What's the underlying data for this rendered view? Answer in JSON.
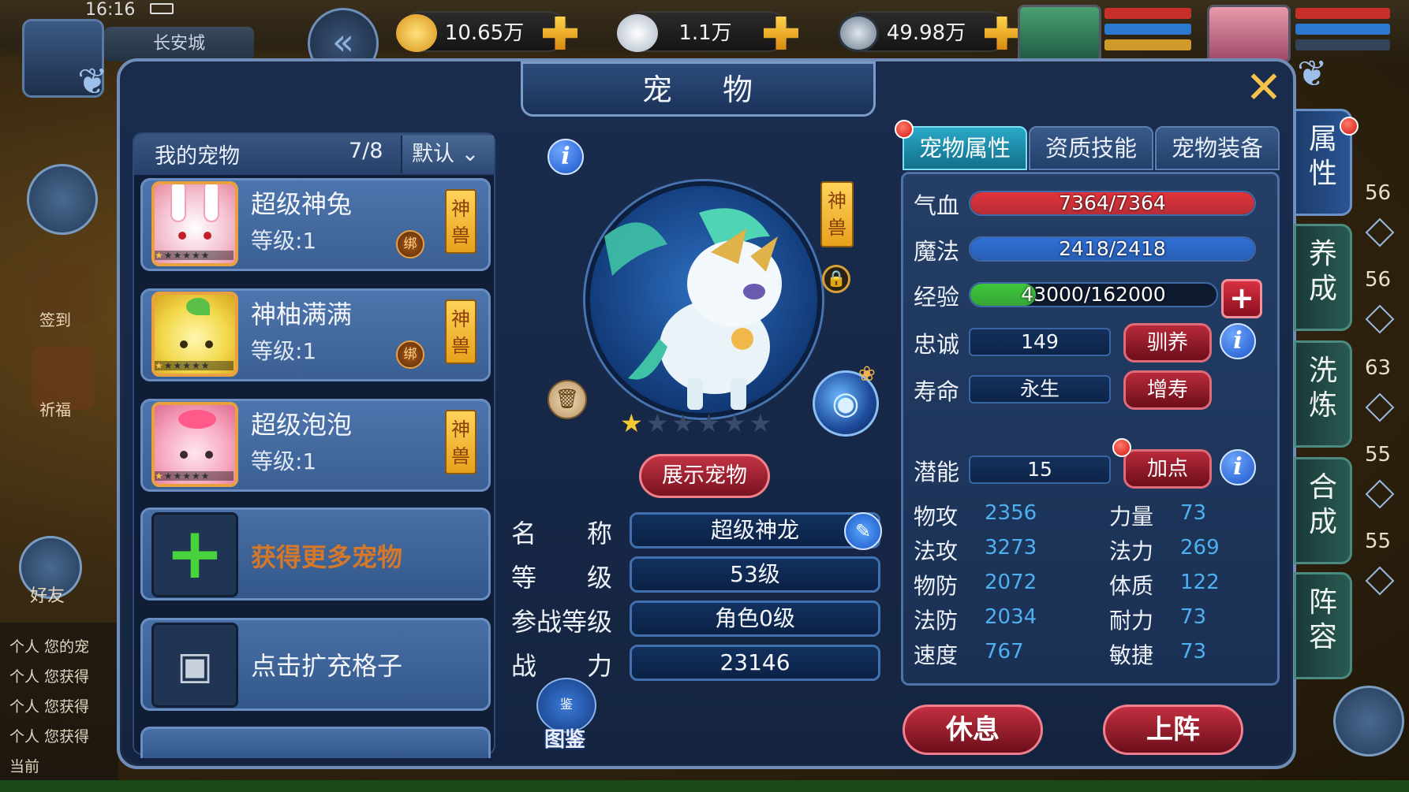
{
  "status": {
    "time": "16:16"
  },
  "hud": {
    "location": "长安城",
    "currencies": [
      {
        "icon": "gold-ingot-icon",
        "value": "10.65万"
      },
      {
        "icon": "silver-ingot-icon",
        "value": "1.1万"
      },
      {
        "icon": "coin-icon",
        "value": "49.98万"
      }
    ]
  },
  "window": {
    "title": "宠 物",
    "close": "✕"
  },
  "pet_list": {
    "header_title": "我的宠物",
    "count": "7/8",
    "sort_label": "默认",
    "pets": [
      {
        "name": "超级神兔",
        "level": "等级:1",
        "bound": "绑",
        "tag": "神兽"
      },
      {
        "name": "神柚满满",
        "level": "等级:1",
        "bound": "绑",
        "tag": "神兽"
      },
      {
        "name": "超级泡泡",
        "level": "等级:1",
        "tag": "神兽"
      }
    ],
    "get_more": "获得更多宠物",
    "expand": "点击扩充格子"
  },
  "pet_detail": {
    "tag": "神兽",
    "stars_filled": 1,
    "stars_total": 6,
    "show_button": "展示宠物",
    "fields": [
      {
        "label": "名　　称",
        "value": "超级神龙"
      },
      {
        "label": "等　　级",
        "value": "53级"
      },
      {
        "label": "参战等级",
        "value": "角色0级"
      },
      {
        "label": "战　　力",
        "value": "23146"
      }
    ],
    "dex_label": "图鉴",
    "dex_icon_text": "鉴"
  },
  "tabs": [
    "宠物属性",
    "资质技能",
    "宠物装备"
  ],
  "attributes": {
    "hp": {
      "label": "气血",
      "value": "7364/7364",
      "ratio": 1.0
    },
    "mp": {
      "label": "魔法",
      "value": "2418/2418",
      "ratio": 1.0
    },
    "exp": {
      "label": "经验",
      "value": "43000/162000",
      "ratio": 0.265
    },
    "loyalty": {
      "label": "忠诚",
      "value": "149",
      "button": "驯养"
    },
    "life": {
      "label": "寿命",
      "value": "永生",
      "button": "增寿"
    },
    "potential": {
      "label": "潜能",
      "value": "15",
      "button": "加点"
    },
    "stats": [
      {
        "label": "物攻",
        "value": "2356",
        "label2": "力量",
        "value2": "73"
      },
      {
        "label": "法攻",
        "value": "3273",
        "label2": "法力",
        "value2": "269"
      },
      {
        "label": "物防",
        "value": "2072",
        "label2": "体质",
        "value2": "122"
      },
      {
        "label": "法防",
        "value": "2034",
        "label2": "耐力",
        "value2": "73"
      },
      {
        "label": "速度",
        "value": "767",
        "label2": "敏捷",
        "value2": "73"
      }
    ]
  },
  "actions": {
    "rest": "休息",
    "deploy": "上阵"
  },
  "side_tabs": [
    "属性",
    "养成",
    "洗炼",
    "合成",
    "阵容"
  ],
  "side_numbers": [
    "56",
    "56",
    "63",
    "55",
    "55"
  ],
  "left_hud": {
    "sign": "签到",
    "pray": "祈福",
    "friends": "好友"
  },
  "chat": [
    "个人 您的宠",
    "个人 您获得",
    "个人 您获得",
    "个人 您获得",
    "当前"
  ],
  "colors": {
    "hp": "#e2333a",
    "mp": "#2f6fd6",
    "exp": "#3fc83a",
    "accent": "#f5c34a",
    "panel": "#1a2c4e"
  }
}
